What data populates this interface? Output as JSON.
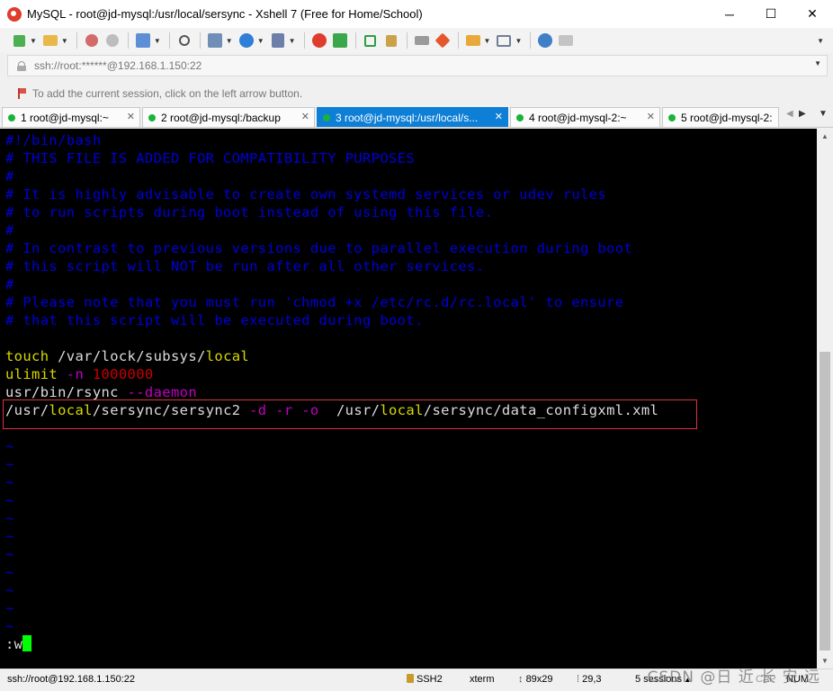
{
  "window": {
    "title": "MySQL - root@jd-mysql:/usr/local/sersync - Xshell 7 (Free for Home/School)",
    "minimize": "─",
    "maximize": "☐",
    "close": "✕"
  },
  "toolbar": {
    "icons": [
      "new-session-icon",
      "open-folder-icon",
      "disconnect-icon",
      "reconnect-icon",
      "properties-icon",
      "find-icon",
      "transfer-icon",
      "globe-icon",
      "font-icon",
      "xshell-icon",
      "xftp-icon",
      "fullscreen-icon",
      "lock-icon",
      "keyboard-icon",
      "highlight-icon",
      "new-tab-icon",
      "layout-icon",
      "help-icon",
      "comment-icon"
    ]
  },
  "address": {
    "value": "ssh://root:******@192.168.1.150:22"
  },
  "hint": {
    "text": "To add the current session, click on the left arrow button."
  },
  "tabs": [
    {
      "label": "1 root@jd-mysql:~",
      "active": false
    },
    {
      "label": "2 root@jd-mysql:/backup",
      "active": false
    },
    {
      "label": "3 root@jd-mysql:/usr/local/s...",
      "active": true
    },
    {
      "label": "4 root@jd-mysql-2:~",
      "active": false
    },
    {
      "label": "5 root@jd-mysql-2:",
      "active": false
    }
  ],
  "terminal": {
    "comments": [
      "#!/bin/bash",
      "# THIS FILE IS ADDED FOR COMPATIBILITY PURPOSES",
      "#",
      "# It is highly advisable to create own systemd services or udev rules",
      "# to run scripts during boot instead of using this file.",
      "#",
      "# In contrast to previous versions due to parallel execution during boot",
      "# this script will NOT be run after all other services.",
      "#",
      "# Please note that you must run 'chmod +x /etc/rc.d/rc.local' to ensure",
      "# that this script will be executed during boot."
    ],
    "line_touch": {
      "cmd": "touch",
      "path1": " /var/lock/subsys/",
      "path2": "local"
    },
    "line_ulimit": {
      "cmd": "ulimit",
      "flag": " -n",
      "value": " 1000000"
    },
    "line_rsync": {
      "path": "usr/bin/rsync ",
      "flag": "--daemon"
    },
    "line_sersync": {
      "p1": "/usr/",
      "p2": "local",
      "p3": "/sersync/sersync2 ",
      "f1": "-d",
      "f2": " -r",
      "f3": " -o",
      "p4": "  /usr/",
      "p5": "local",
      "p6": "/sersync/data_configxml.xml"
    },
    "tilde": "~",
    "command": ":w"
  },
  "status": {
    "address": "ssh://root@192.168.1.150:22",
    "protocol": "SSH2",
    "term_type": "xterm",
    "size": "89x29",
    "position": "29,3",
    "sessions": "5 sessions",
    "caps": "CAP",
    "num": "NUM"
  },
  "watermark": "CSDN @日 近 长 安 远"
}
